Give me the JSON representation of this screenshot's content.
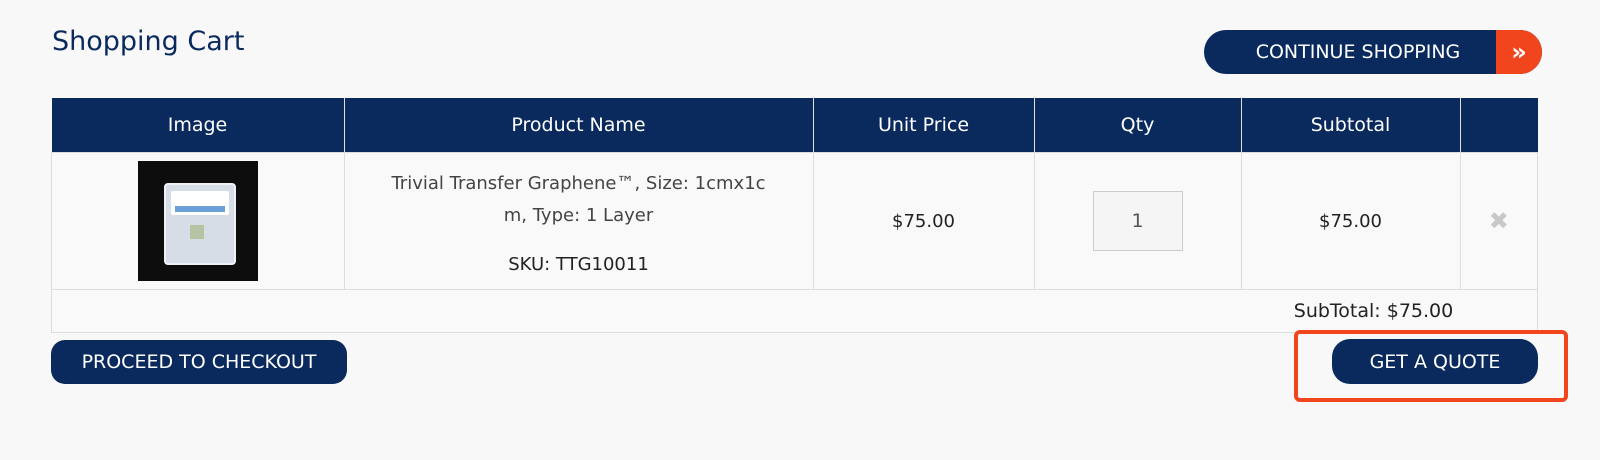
{
  "page": {
    "title": "Shopping Cart"
  },
  "header": {
    "continue_label": "CONTINUE SHOPPING",
    "continue_icon": "double-chevron-right-icon",
    "accent": "#f0451d",
    "brand": "#0a2a5e"
  },
  "table": {
    "headers": [
      "Image",
      "Product Name",
      "Unit Price",
      "Qty",
      "Subtotal",
      ""
    ],
    "items": [
      {
        "name": "Trivial Transfer Graphene™, Size: 1cmx1cm, Type: 1 Layer",
        "name_line1": "Trivial Transfer Graphene™, Size: 1cmx1c",
        "name_line2": "m, Type: 1 Layer",
        "sku": "SKU: TTG10011",
        "unit_price": "$75.00",
        "qty": "1",
        "subtotal": "$75.00",
        "remove_icon": "remove-x-icon"
      }
    ],
    "subtotal_label": "SubTotal: $75.00"
  },
  "actions": {
    "checkout_label": "PROCEED TO CHECKOUT",
    "quote_label": "GET A QUOTE"
  }
}
